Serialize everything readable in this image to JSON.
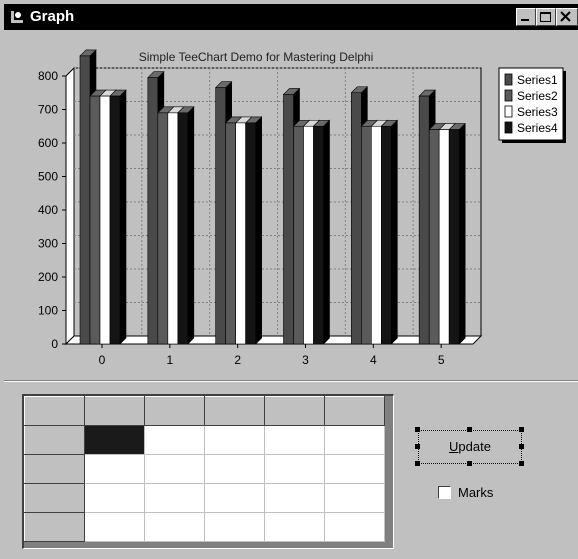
{
  "window": {
    "title": "Graph",
    "buttons": [
      "minimize-button",
      "maximize-button",
      "close-button"
    ]
  },
  "chart_data": {
    "type": "bar",
    "title": "Simple TeeChart Demo for Mastering Delphi",
    "xlabel": "",
    "ylabel": "",
    "three_d": true,
    "categories": [
      "0",
      "1",
      "2",
      "3",
      "4",
      "5"
    ],
    "ylim": [
      0,
      800
    ],
    "yticks": [
      0,
      100,
      200,
      300,
      400,
      500,
      600,
      700,
      800
    ],
    "grid": true,
    "legend_position": "top-right",
    "series": [
      {
        "name": "Series1",
        "color": "#4a4a4a",
        "values": [
          860,
          795,
          765,
          745,
          750,
          740
        ]
      },
      {
        "name": "Series2",
        "color": "#5a5a5a",
        "values": [
          740,
          690,
          660,
          650,
          650,
          640
        ]
      },
      {
        "name": "Series3",
        "color": "#ffffff",
        "values": [
          740,
          690,
          660,
          650,
          650,
          640
        ]
      },
      {
        "name": "Series4",
        "color": "#141414",
        "values": [
          740,
          690,
          660,
          650,
          650,
          640
        ]
      }
    ]
  },
  "grid_table": {
    "columns": 6,
    "rows": 5,
    "selected_cell": [
      1,
      1
    ]
  },
  "controls": {
    "update_label_accel": "U",
    "update_label_rest": "pdate",
    "marks_label": "Marks",
    "marks_checked": false
  }
}
